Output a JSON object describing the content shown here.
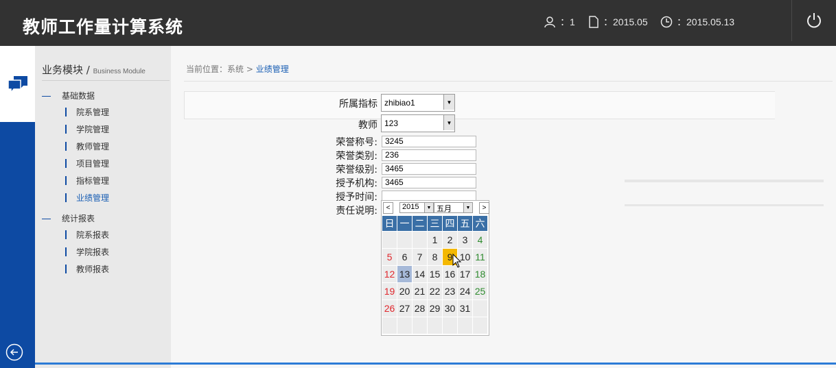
{
  "header": {
    "title": "教师工作量计算系统",
    "user_count": "：1",
    "period": "：2015.05",
    "date": "：2015.05.13"
  },
  "sidebar": {
    "module_title": "业务模块",
    "module_sep": "/",
    "module_en": "Business Module",
    "groups": [
      {
        "label": "基础数据",
        "items": [
          "院系管理",
          "学院管理",
          "教师管理",
          "项目管理",
          "指标管理",
          "业绩管理"
        ]
      },
      {
        "label": "统计报表",
        "items": [
          "院系报表",
          "学院报表",
          "教师报表"
        ]
      }
    ]
  },
  "breadcrumb": {
    "prefix": "当前位置：系统 > ",
    "current": "业绩管理"
  },
  "form": {
    "indicator_label": "所属指标",
    "indicator_value": "zhibiao1",
    "teacher_label": "教师",
    "teacher_value": "123",
    "honor_title_label": "荣誉称号:",
    "honor_title_value": "3245",
    "honor_type_label": "荣誉类别:",
    "honor_type_value": "236",
    "honor_level_label": "荣誉级别:",
    "honor_level_value": "3465",
    "grant_org_label": "授予机构:",
    "grant_org_value": "3465",
    "grant_time_label": "授予时间:",
    "grant_time_value": "",
    "duty_label": "责任说明:"
  },
  "calendar": {
    "prev": "<",
    "next": ">",
    "year": "2015",
    "month": "五月",
    "weekdays": [
      "日",
      "一",
      "二",
      "三",
      "四",
      "五",
      "六"
    ],
    "weeks": [
      [
        "",
        "",
        "",
        "",
        "1",
        "2",
        "3",
        "4"
      ],
      [
        "5",
        "6",
        "7",
        "8",
        "9",
        "10",
        "11"
      ],
      [
        "12",
        "13",
        "14",
        "15",
        "16",
        "17",
        "18"
      ],
      [
        "19",
        "20",
        "21",
        "22",
        "23",
        "24",
        "25"
      ],
      [
        "26",
        "27",
        "28",
        "29",
        "30",
        "31",
        ""
      ],
      [
        "",
        "",
        "",
        "",
        "",
        "",
        ""
      ]
    ],
    "today": "13",
    "hovered": "9"
  },
  "colors": {
    "header_bg": "#323232",
    "accent": "#0d4aa3",
    "link": "#1a5fb4",
    "calendar_head": "#3a6fa6",
    "hover": "#f4b800"
  }
}
